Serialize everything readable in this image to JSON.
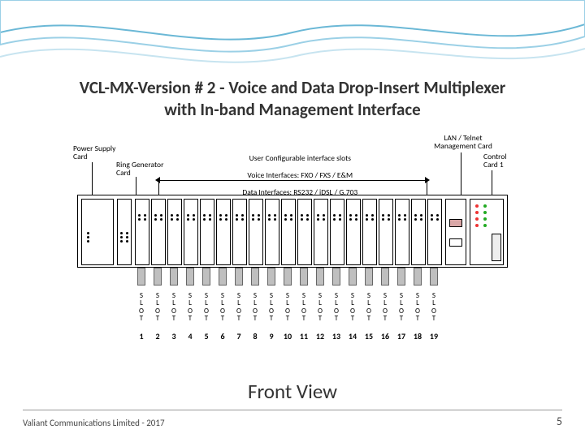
{
  "title_line1": "VCL-MX-Version # 2 - Voice and Data Drop-Insert Multiplexer",
  "title_line2": "with In-band Management Interface",
  "labels": {
    "power_supply": "Power Supply\nCard",
    "ring_gen": "Ring Generator\nCard",
    "user_cfg_1": "User Configurable interface slots",
    "user_cfg_2": "Voice Interfaces: FXO / FXS / E&M",
    "user_cfg_3": "Data Interfaces: RS232 / iDSL / G.703",
    "lan_mgmt": "LAN / Telnet\nManagement Card",
    "control_card": "Control\nCard 1"
  },
  "slot_label": "S\nL\nO\nT",
  "slot_numbers": [
    "1",
    "2",
    "3",
    "4",
    "5",
    "6",
    "7",
    "8",
    "9",
    "10",
    "11",
    "12",
    "13",
    "14",
    "15",
    "16",
    "17",
    "18",
    "19"
  ],
  "slide_label": "Front View",
  "footer_company": "Valiant Communications Limited - 2017",
  "page_number": "5"
}
